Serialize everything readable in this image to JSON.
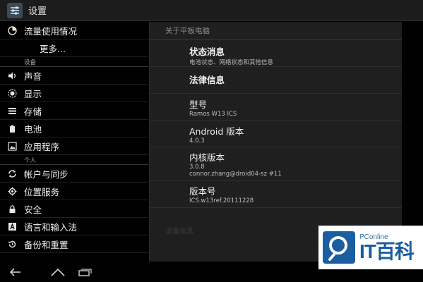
{
  "actionbar": {
    "title": "设置"
  },
  "left": {
    "items": [
      {
        "label": "流量使用情况",
        "icon": "data-usage-icon"
      },
      {
        "label": "更多...",
        "icon": ""
      }
    ],
    "device_category": "设备",
    "device_items": [
      {
        "label": "声音",
        "icon": "sound-icon"
      },
      {
        "label": "显示",
        "icon": "display-icon"
      },
      {
        "label": "存储",
        "icon": "storage-icon"
      },
      {
        "label": "电池",
        "icon": "battery-icon"
      },
      {
        "label": "应用程序",
        "icon": "apps-icon"
      }
    ],
    "personal_category": "个人",
    "personal_items": [
      {
        "label": "帐户与同步",
        "icon": "sync-icon"
      },
      {
        "label": "位置服务",
        "icon": "location-icon"
      },
      {
        "label": "安全",
        "icon": "lock-icon"
      },
      {
        "label": "语言和输入法",
        "icon": "keyboard-icon"
      },
      {
        "label": "备份和重置",
        "icon": "backup-icon"
      }
    ]
  },
  "right": {
    "header": "关于平板电脑",
    "status": {
      "title": "状态消息",
      "summary": "电池状态、网络状态和其他信息"
    },
    "legal": {
      "title": "法律信息"
    },
    "model": {
      "title": "型号",
      "value": "Ramos W13 ICS"
    },
    "android": {
      "title": "Android 版本",
      "value": "4.0.3"
    },
    "kernel": {
      "title": "内核版本",
      "value_line1": "3.0.8",
      "value_line2": "connor.zhang@droid04-sz #11"
    },
    "build": {
      "title": "版本号",
      "value": "ICS.w13ref.20111228"
    },
    "faded_text": "设备信息"
  },
  "watermark": {
    "small": "PConline",
    "big": "IT百科"
  },
  "colors": {
    "pane_bg": "#1f1f1f",
    "actionbar_bg": "#1c1c1c",
    "brand_blue": "#1a5ea0"
  }
}
